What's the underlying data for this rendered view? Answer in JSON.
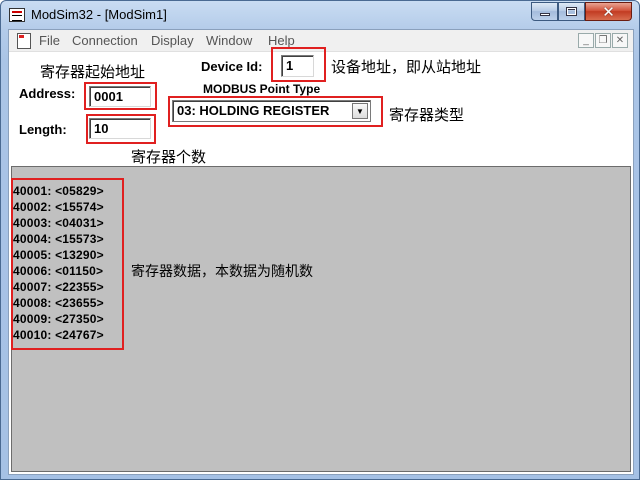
{
  "window": {
    "title": "ModSim32 - [ModSim1]"
  },
  "menu": {
    "items": [
      "File",
      "Connection",
      "Display",
      "Window",
      "Help"
    ]
  },
  "form": {
    "address_label": "Address:",
    "address_value": "0001",
    "length_label": "Length:",
    "length_value": "10",
    "device_id_label": "Device Id:",
    "device_id_value": "1",
    "point_type_label": "MODBUS Point Type",
    "point_type_value": "03: HOLDING REGISTER"
  },
  "annotations": {
    "start_address": "寄存器起始地址",
    "device_address": "设备地址，即从站地址",
    "register_type": "寄存器类型",
    "register_count": "寄存器个数",
    "register_data": "寄存器数据，本数据为随机数"
  },
  "registers": [
    "40001: <05829>",
    "40002: <15574>",
    "40003: <04031>",
    "40004: <15573>",
    "40005: <13290>",
    "40006: <01150>",
    "40007: <22355>",
    "40008: <23655>",
    "40009: <27350>",
    "40010: <24767>"
  ],
  "colors": {
    "highlight_box": "#e02020",
    "data_background": "#c0c0c0"
  }
}
